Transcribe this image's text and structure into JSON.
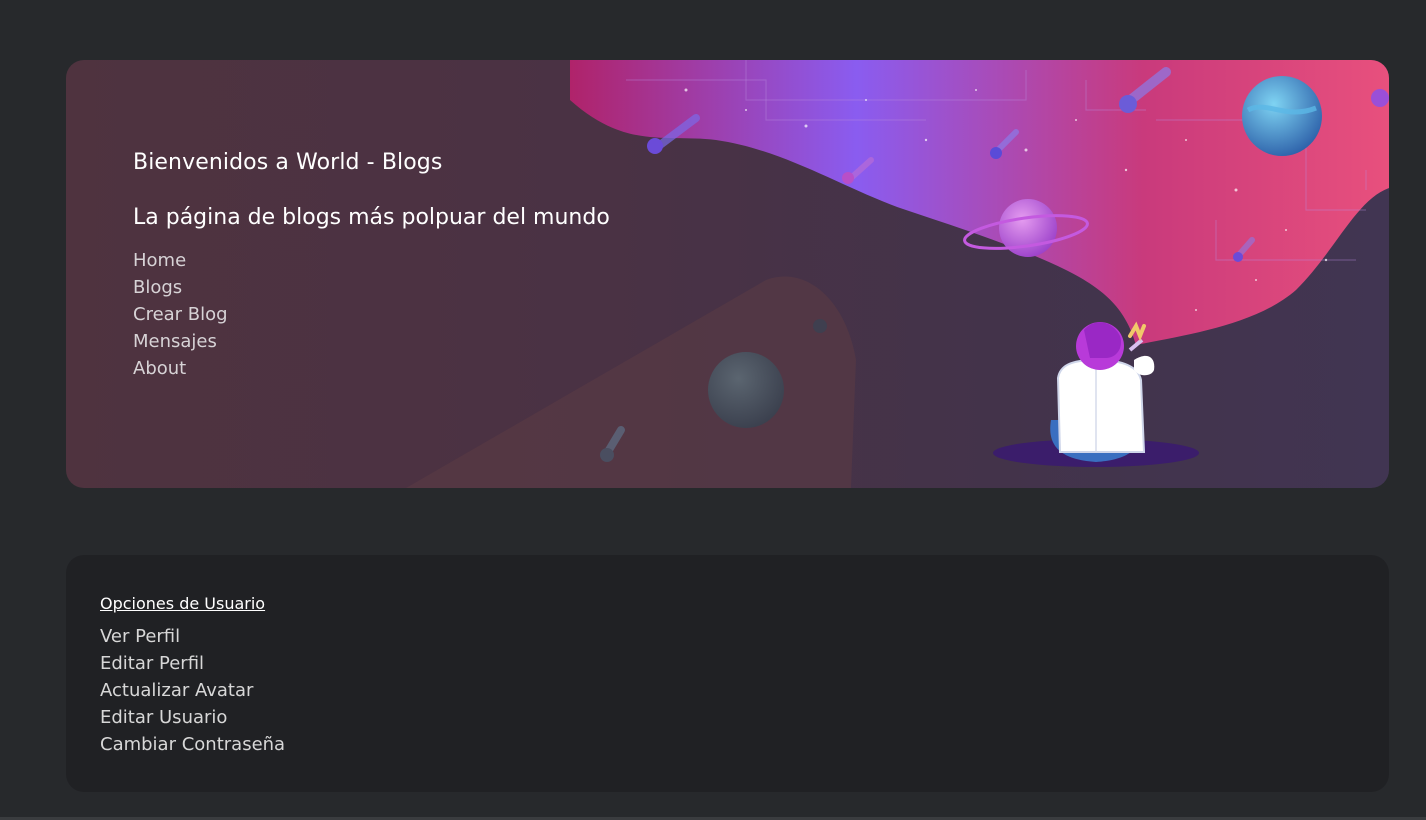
{
  "hero": {
    "title": "Bienvenidos a World - Blogs",
    "subtitle": "La página de blogs más polpuar del mundo",
    "nav": [
      {
        "label": "Home"
      },
      {
        "label": "Blogs"
      },
      {
        "label": "Crear Blog"
      },
      {
        "label": "Mensajes"
      },
      {
        "label": "About"
      }
    ],
    "illustration_icon": "astronaut-space-illustration"
  },
  "user_options": {
    "heading": "Opciones de Usuario",
    "items": [
      {
        "label": "Ver Perfil"
      },
      {
        "label": "Editar Perfil"
      },
      {
        "label": "Actualizar Avatar"
      },
      {
        "label": "Editar Usuario"
      },
      {
        "label": "Cambiar Contraseña"
      }
    ]
  },
  "colors": {
    "page_background": "#27292c",
    "card_background": "#202124",
    "accent_pink": "#e8477a",
    "accent_violet": "#8a5cf0"
  }
}
